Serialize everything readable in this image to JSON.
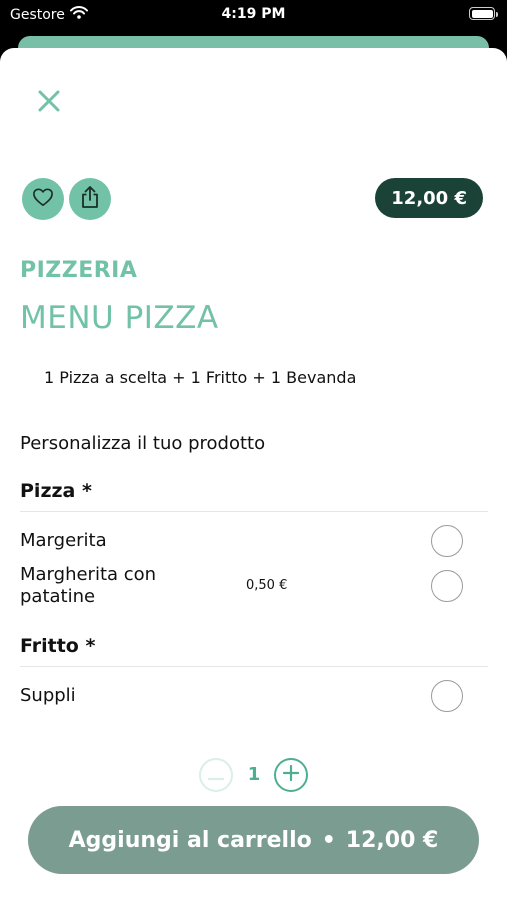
{
  "status_bar": {
    "carrier": "Gestore",
    "time": "4:19 PM"
  },
  "product": {
    "price": "12,00 €",
    "category": "PIZZERIA",
    "title": "MENU PIZZA",
    "description": "1 Pizza a scelta + 1 Fritto + 1 Bevanda"
  },
  "customize_label": "Personalizza il tuo prodotto",
  "sections": [
    {
      "title": "Pizza *",
      "options": [
        {
          "label": "Margerita",
          "price": ""
        },
        {
          "label": "Margherita con patatine",
          "price": "0,50 €"
        }
      ]
    },
    {
      "title": "Fritto *",
      "options": [
        {
          "label": "Suppli",
          "price": ""
        }
      ]
    }
  ],
  "quantity": "1",
  "cart_button": {
    "label": "Aggiungi al carrello",
    "separator": "•",
    "total": "12,00 €"
  },
  "icons": {
    "close": "close-icon",
    "favorite": "heart-icon",
    "share": "share-icon",
    "minus": "minus-icon",
    "plus": "plus-icon",
    "wifi": "wifi-icon",
    "battery": "battery-icon"
  },
  "colors": {
    "accent": "#72c2a8",
    "price_pill": "#1a4236",
    "cart_button": "#7b9c91"
  }
}
